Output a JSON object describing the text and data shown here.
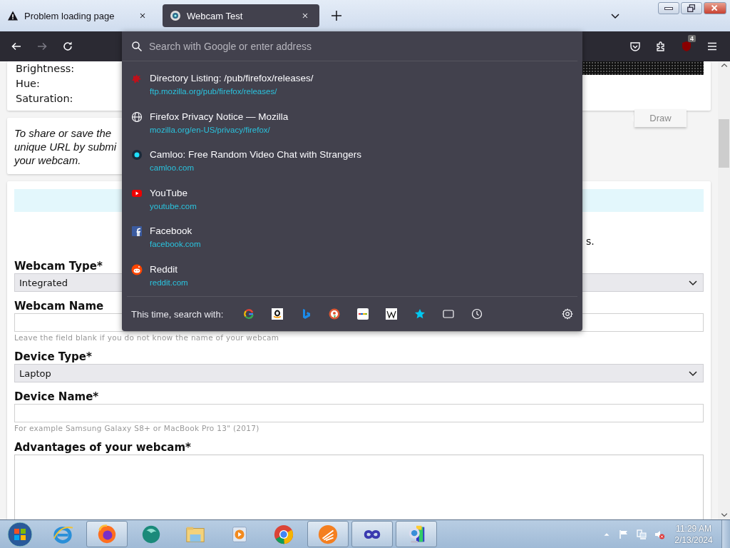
{
  "tabs": [
    {
      "title": "Problem loading page",
      "kind": "warning",
      "selected": false
    },
    {
      "title": "Webcam Test",
      "kind": "webcam",
      "selected": true
    }
  ],
  "toolbar": {
    "nav_buttons": [
      {
        "kind": "back",
        "disabled": false
      },
      {
        "kind": "forward",
        "disabled": true
      },
      {
        "kind": "reload",
        "disabled": false
      }
    ],
    "extension_badge": "4"
  },
  "urlbar": {
    "placeholder": "Search with Google or enter address",
    "suggestions": [
      {
        "kind": "splat",
        "title": "Directory Listing: /pub/firefox/releases/",
        "url": "ftp.mozilla.org/pub/firefox/releases/"
      },
      {
        "kind": "globe",
        "title": "Firefox Privacy Notice — Mozilla",
        "url": "mozilla.org/en-US/privacy/firefox/"
      },
      {
        "kind": "dot",
        "title": "Camloo: Free Random Video Chat with Strangers",
        "url": "camloo.com"
      },
      {
        "kind": "play",
        "title": "YouTube",
        "url": "youtube.com"
      },
      {
        "kind": "square",
        "title": "Facebook",
        "url": "facebook.com"
      },
      {
        "kind": "alien",
        "title": "Reddit",
        "url": "reddit.com"
      }
    ],
    "search_with": {
      "label": "This time, search with:",
      "engines": [
        {
          "kind": "google"
        },
        {
          "kind": "amazon"
        },
        {
          "kind": "bing"
        },
        {
          "kind": "duck"
        },
        {
          "kind": "ebay"
        },
        {
          "kind": "wiki"
        },
        {
          "kind": "bookmarks"
        },
        {
          "kind": "tabs"
        },
        {
          "kind": "history"
        }
      ]
    }
  },
  "page": {
    "adjustments": [
      "Brightness:",
      "Hue:",
      "Saturation:"
    ],
    "share_note": [
      "To share or save the",
      "unique URL by submi",
      "your webcam."
    ],
    "draw_button": "Draw",
    "banner_tail": "s.",
    "form": [
      {
        "kind": "select",
        "label": "Webcam Type*",
        "value": "Integrated"
      },
      {
        "kind": "input",
        "label": "Webcam Name",
        "hint": "Leave the field blank if you do not know the name of your webcam"
      },
      {
        "kind": "select",
        "label": "Device Type*",
        "value": "Laptop"
      },
      {
        "kind": "input",
        "label": "Device Name*",
        "hint": "For example Samsung Galaxy S8+ or MacBook Pro 13\" (2017)"
      },
      {
        "kind": "textarea",
        "label": "Advantages of your webcam*"
      }
    ]
  },
  "taskbar": {
    "apps": [
      {
        "kind": "ie",
        "running": false
      },
      {
        "kind": "firefox",
        "running": true
      },
      {
        "kind": "bubble",
        "running": false
      },
      {
        "kind": "folder",
        "running": false
      },
      {
        "kind": "media",
        "running": false
      },
      {
        "kind": "chrome",
        "running": false
      },
      {
        "kind": "orange",
        "running": true
      },
      {
        "kind": "infinity",
        "running": true
      },
      {
        "kind": "webcam",
        "running": true
      }
    ],
    "time": "11:29 AM",
    "date": "2/13/2024"
  }
}
